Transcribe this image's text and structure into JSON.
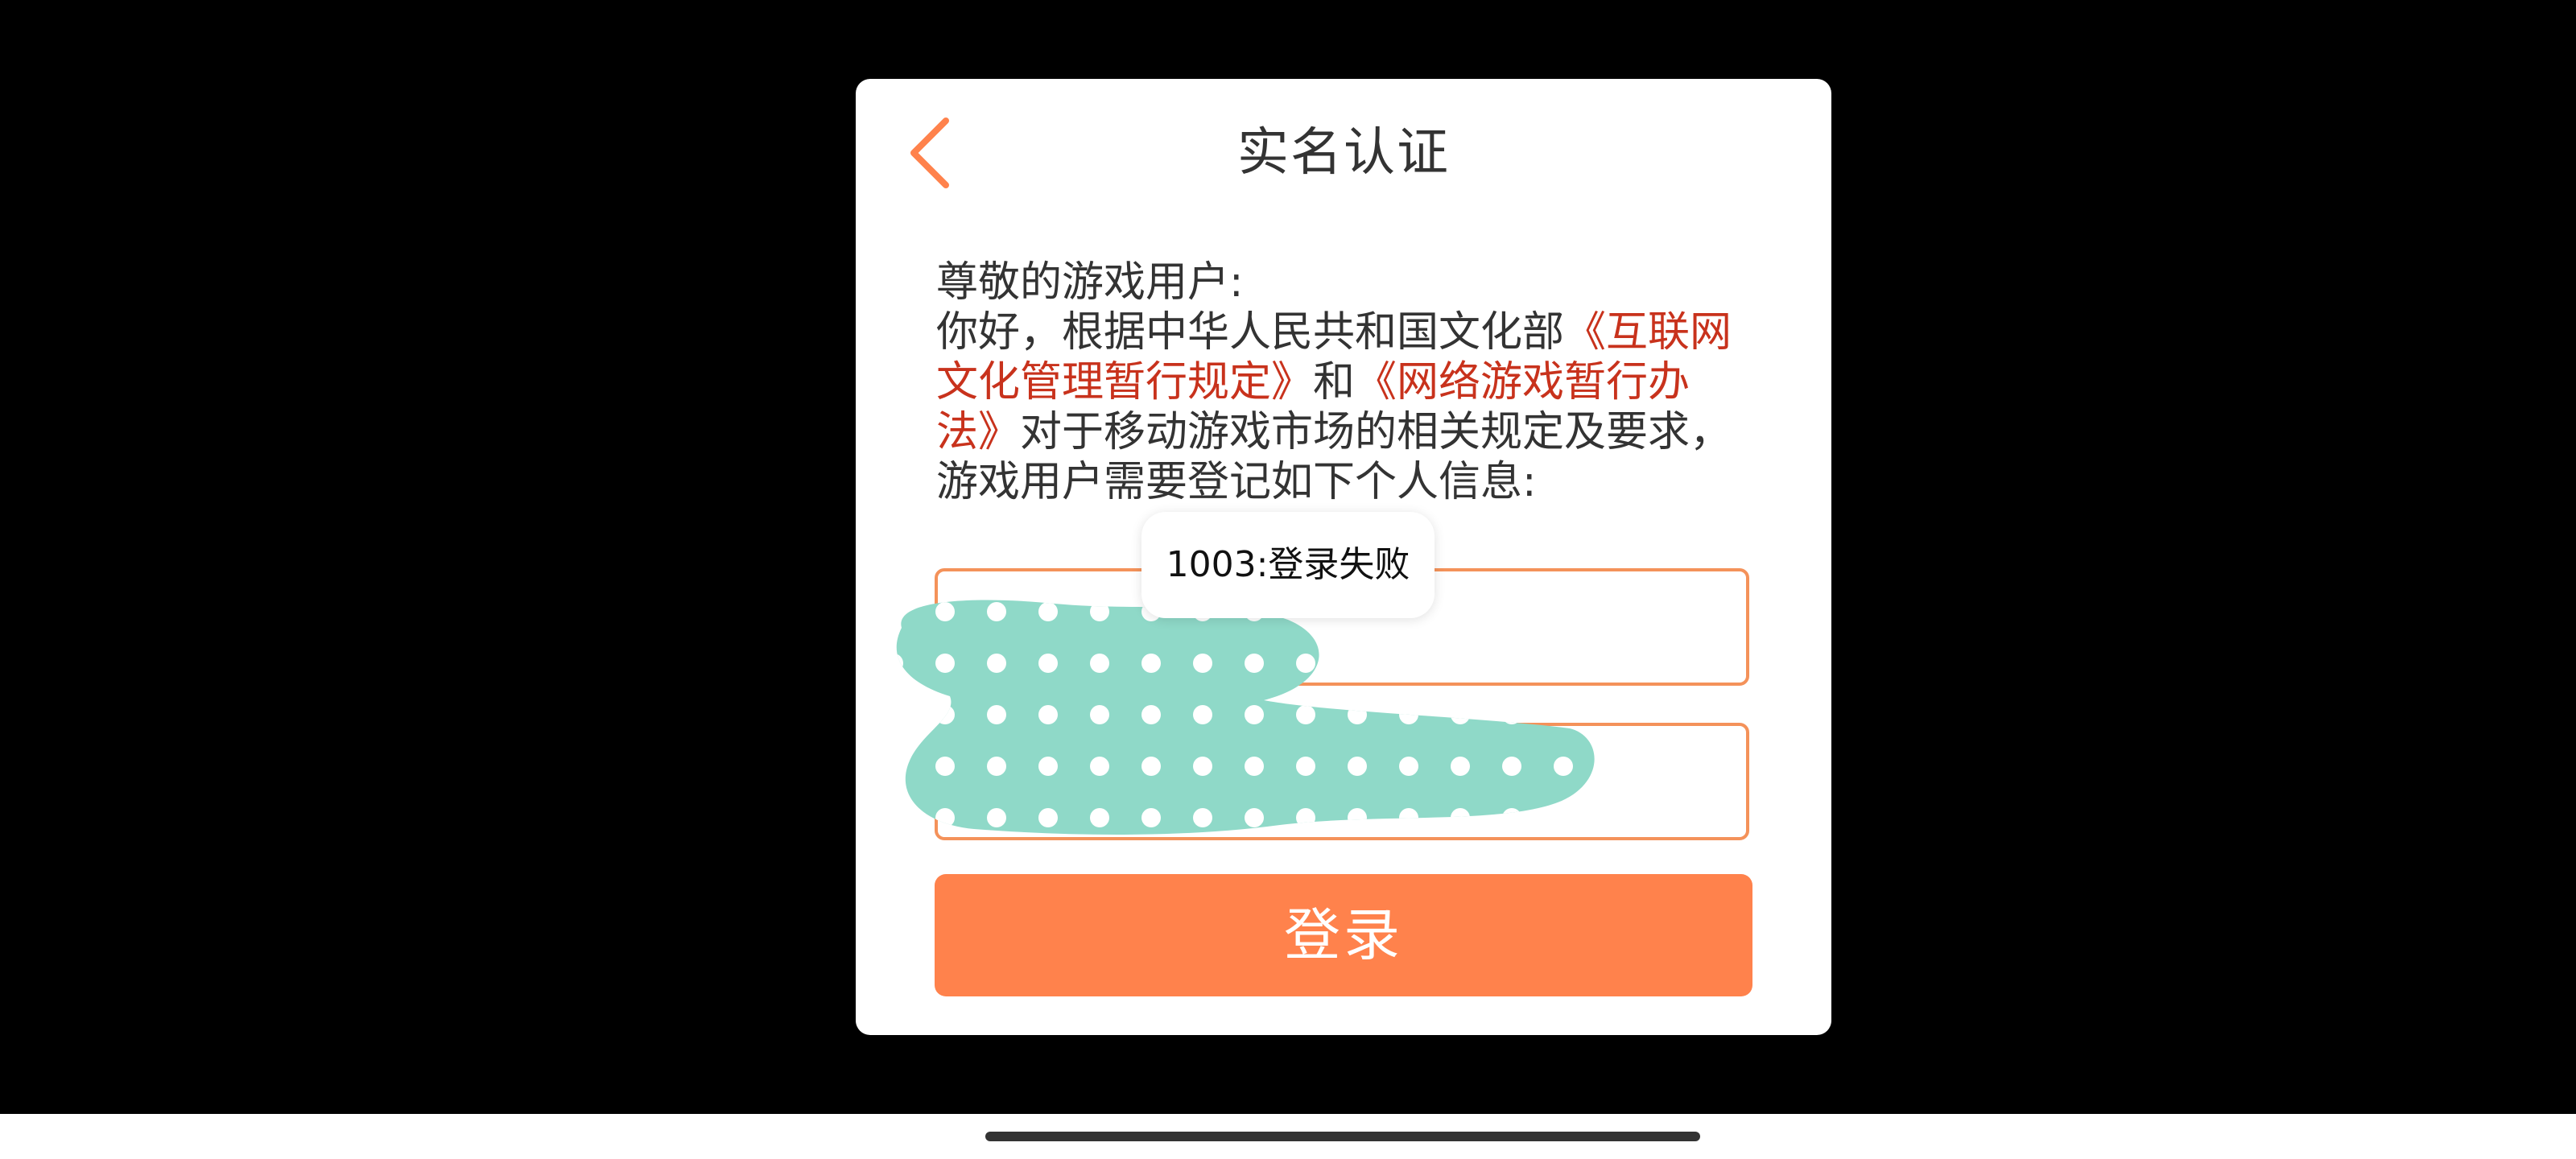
{
  "dialog": {
    "title": "实名认证",
    "back_icon": "chevron-left-icon",
    "notice": {
      "greeting": "尊敬的游戏用户:",
      "part1": "你好，根据中华人民共和国文化部",
      "link1": "《互联网文化管理暂行规定》",
      "part2": "和",
      "link2": "《网络游戏暂行办法》",
      "part3": "对于移动游戏市场的相关规定及要求，游戏用户需要登记如下个人信息:"
    },
    "name_input": {
      "value": "",
      "placeholder": ""
    },
    "id_input": {
      "value": "",
      "placeholder": ""
    },
    "login_label": "登录"
  },
  "toast": {
    "message": "1003:登录失败"
  },
  "colors": {
    "accent": "#ff824c",
    "input_border": "#f4925a",
    "link": "#c8321c",
    "text": "#333333",
    "redaction": "#8fd9c8"
  }
}
